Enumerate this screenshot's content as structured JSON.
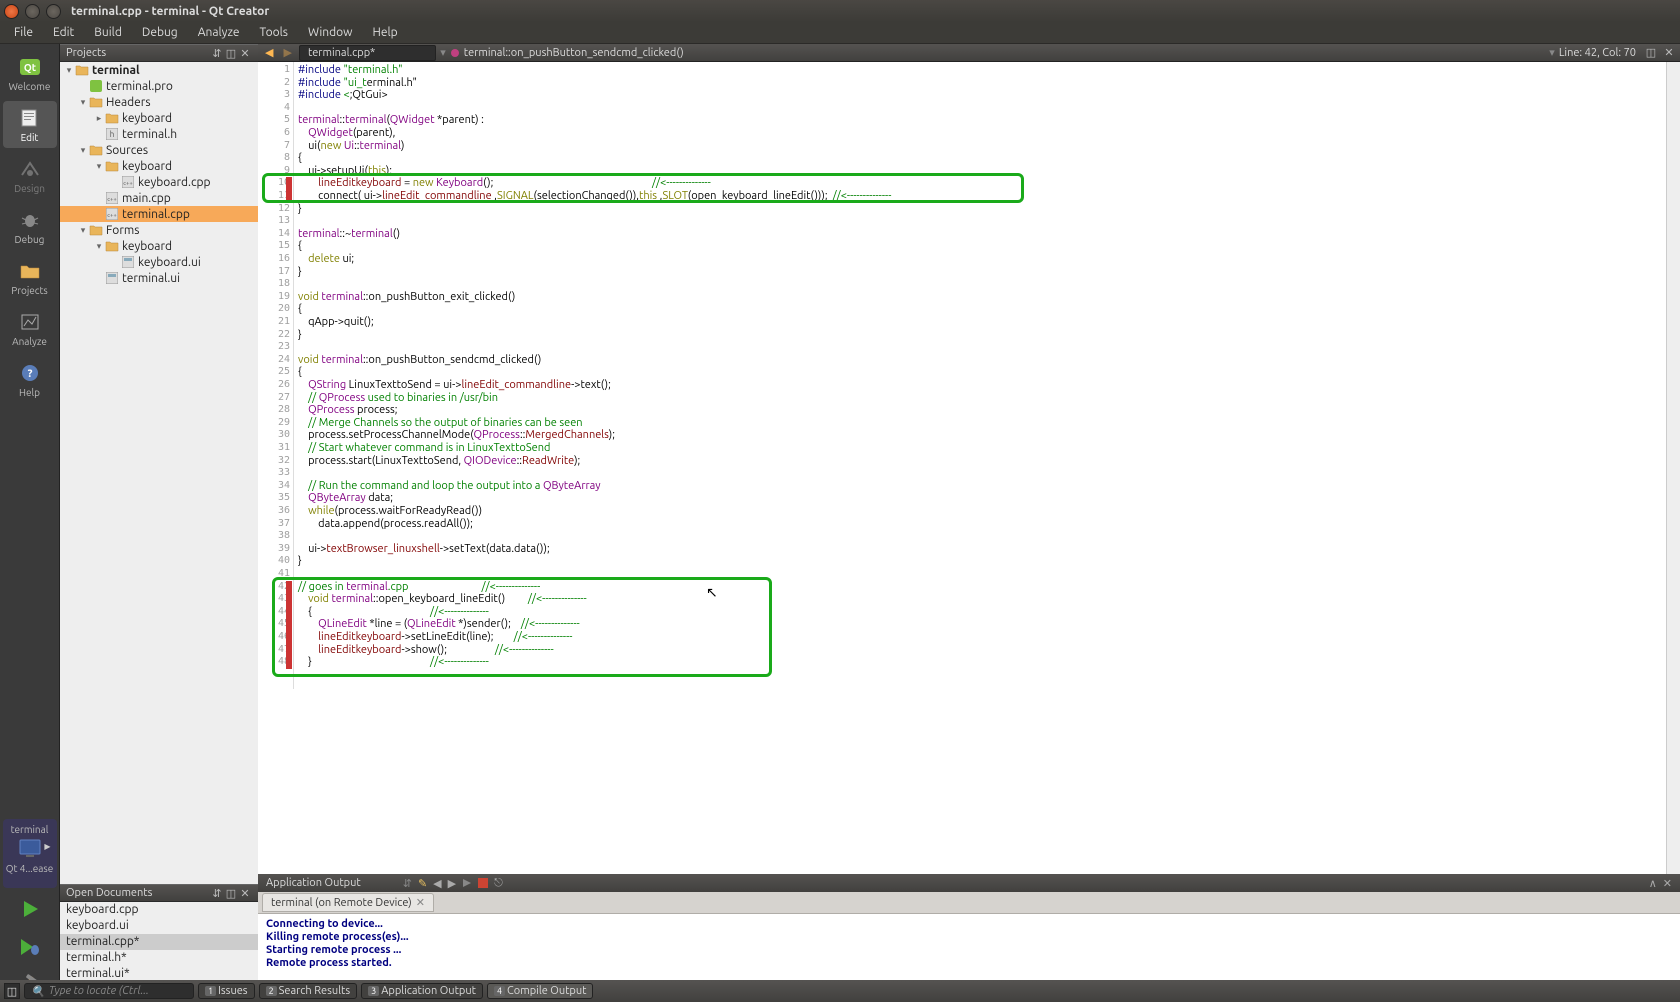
{
  "window": {
    "title": "terminal.cpp - terminal - Qt Creator"
  },
  "menu": {
    "file": "File",
    "edit": "Edit",
    "build": "Build",
    "debug": "Debug",
    "analyze": "Analyze",
    "tools": "Tools",
    "window": "Window",
    "help": "Help"
  },
  "rail": {
    "welcome": "Welcome",
    "edit": "Edit",
    "design": "Design",
    "debug": "Debug",
    "projects": "Projects",
    "analyze": "Analyze",
    "help": "Help",
    "kit": "terminal",
    "kit2": "Qt 4...ease"
  },
  "panels": {
    "projects": "Projects",
    "opendocs": "Open Documents"
  },
  "tree": {
    "root": "terminal",
    "pro": "terminal.pro",
    "headers": "Headers",
    "headers_kb": "keyboard",
    "terminal_h": "terminal.h",
    "sources": "Sources",
    "sources_kb": "keyboard",
    "keyboard_cpp": "keyboard.cpp",
    "main_cpp": "main.cpp",
    "terminal_cpp": "terminal.cpp",
    "forms": "Forms",
    "forms_kb": "keyboard",
    "keyboard_ui": "keyboard.ui",
    "terminal_ui": "terminal.ui"
  },
  "opendocs": {
    "items": [
      "keyboard.cpp",
      "keyboard.ui",
      "terminal.cpp*",
      "terminal.h*",
      "terminal.ui*"
    ],
    "active": 2
  },
  "editor": {
    "file": "terminal.cpp*",
    "crumb": "terminal::on_pushButton_sendcmd_clicked()",
    "linecol": "Line: 42, Col: 70",
    "lines": [
      "#include \"terminal.h\"",
      "#include \"ui_terminal.h\"",
      "#include <QtGui>",
      "",
      "terminal::terminal(QWidget *parent) :",
      "    QWidget(parent),",
      "    ui(new Ui::terminal)",
      "{",
      "    ui->setupUi(this);",
      "        lineEditkeyboard = new Keyboard();                                                               //<--------------",
      "        connect( ui->lineEdit_commandline ,SIGNAL(selectionChanged()),this ,SLOT(open_keyboard_lineEdit()));  //<--------------",
      "}",
      "",
      "terminal::~terminal()",
      "{",
      "    delete ui;",
      "}",
      "",
      "void terminal::on_pushButton_exit_clicked()",
      "{",
      "    qApp->quit();",
      "}",
      "",
      "void terminal::on_pushButton_sendcmd_clicked()",
      "{",
      "    QString LinuxTexttoSend = ui->lineEdit_commandline->text();",
      "    // QProcess used to binaries in /usr/bin",
      "    QProcess process;",
      "    // Merge Channels so the output of binaries can be seen",
      "    process.setProcessChannelMode(QProcess::MergedChannels);",
      "    // Start whatever command is in LinuxTexttoSend",
      "    process.start(LinuxTexttoSend, QIODevice::ReadWrite);",
      "",
      "    // Run the command and loop the output into a QByteArray",
      "    QByteArray data;",
      "    while(process.waitForReadyRead())",
      "        data.append(process.readAll());",
      "",
      "    ui->textBrowser_linuxshell->setText(data.data());",
      "}",
      "",
      "// goes in terminal.cpp                             //<--------------",
      "    void terminal::open_keyboard_lineEdit()         //<--------------",
      "    {                                               //<--------------",
      "        QLineEdit *line = (QLineEdit *)sender();    //<--------------",
      "        lineEditkeyboard->setLineEdit(line);        //<--------------",
      "        lineEditkeyboard->show();                   //<--------------",
      "    }                                               //<--------------"
    ]
  },
  "output": {
    "title": "Application Output",
    "tab": "terminal (on Remote Device)",
    "lines": [
      "Connecting to device...",
      "Killing remote process(es)...",
      "Starting remote process ...",
      "Remote process started."
    ]
  },
  "status": {
    "locate_placeholder": "Type to locate (Ctrl...",
    "issues": "Issues",
    "search": "Search Results",
    "appout": "Application Output",
    "compile": "Compile Output"
  }
}
